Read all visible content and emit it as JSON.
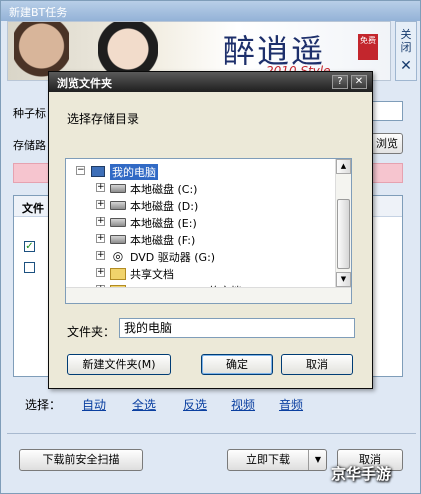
{
  "outer_window": {
    "title": "新建BT任务",
    "close_strip_label": "关闭",
    "close_glyph": "✕",
    "banner": {
      "logo_text": "醉逍遥",
      "logo_sub": "2010 Style",
      "seal_text": "免费"
    },
    "seed_label": "种子标",
    "storage_label": "存储路",
    "browse_peek": "浏览",
    "files_header": "文件",
    "filter": {
      "label": "选择：",
      "links": [
        "自动",
        "全选",
        "反选",
        "视频",
        "音频"
      ]
    },
    "scan_button": "下载前安全扫描",
    "download_button": "立即下载",
    "download_arrow": "▼",
    "cancel_button": "取消",
    "watermark": "京华手游"
  },
  "dialog": {
    "title": "浏览文件夹",
    "help_glyph": "?",
    "close_glyph": "✕",
    "prompt": "选择存储目录",
    "tree": [
      {
        "label": "我的电脑",
        "icon": "computer-icon",
        "selected": true,
        "expander": "−",
        "level": 0
      },
      {
        "label": "本地磁盘 (C:)",
        "icon": "drive-icon",
        "selected": false,
        "expander": "+",
        "level": 1
      },
      {
        "label": "本地磁盘 (D:)",
        "icon": "drive-icon",
        "selected": false,
        "expander": "+",
        "level": 1
      },
      {
        "label": "本地磁盘 (E:)",
        "icon": "drive-icon",
        "selected": false,
        "expander": "+",
        "level": 1
      },
      {
        "label": "本地磁盘 (F:)",
        "icon": "drive-icon",
        "selected": false,
        "expander": "+",
        "level": 1
      },
      {
        "label": "DVD 驱动器 (G:)",
        "icon": "dvd-icon",
        "selected": false,
        "expander": "+",
        "level": 1
      },
      {
        "label": "共享文档",
        "icon": "folder-icon",
        "selected": false,
        "expander": "+",
        "level": 1
      },
      {
        "label": "Administrator 的文档",
        "icon": "folder-icon",
        "selected": false,
        "expander": "+",
        "level": 1
      }
    ],
    "folder_label": "文件夹：",
    "folder_value": "我的电脑",
    "new_folder_button": "新建文件夹(M)",
    "ok_button": "确定",
    "cancel_button": "取消"
  }
}
